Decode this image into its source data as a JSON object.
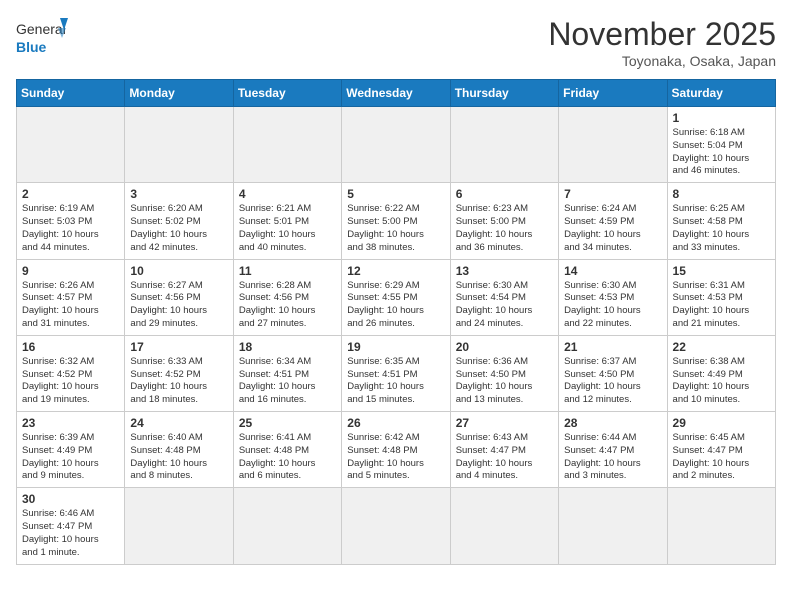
{
  "logo": {
    "text_general": "General",
    "text_blue": "Blue"
  },
  "title": "November 2025",
  "subtitle": "Toyonaka, Osaka, Japan",
  "weekdays": [
    "Sunday",
    "Monday",
    "Tuesday",
    "Wednesday",
    "Thursday",
    "Friday",
    "Saturday"
  ],
  "weeks": [
    [
      {
        "day": "",
        "info": "",
        "empty": true
      },
      {
        "day": "",
        "info": "",
        "empty": true
      },
      {
        "day": "",
        "info": "",
        "empty": true
      },
      {
        "day": "",
        "info": "",
        "empty": true
      },
      {
        "day": "",
        "info": "",
        "empty": true
      },
      {
        "day": "",
        "info": "",
        "empty": true
      },
      {
        "day": "1",
        "info": "Sunrise: 6:18 AM\nSunset: 5:04 PM\nDaylight: 10 hours\nand 46 minutes."
      }
    ],
    [
      {
        "day": "2",
        "info": "Sunrise: 6:19 AM\nSunset: 5:03 PM\nDaylight: 10 hours\nand 44 minutes."
      },
      {
        "day": "3",
        "info": "Sunrise: 6:20 AM\nSunset: 5:02 PM\nDaylight: 10 hours\nand 42 minutes."
      },
      {
        "day": "4",
        "info": "Sunrise: 6:21 AM\nSunset: 5:01 PM\nDaylight: 10 hours\nand 40 minutes."
      },
      {
        "day": "5",
        "info": "Sunrise: 6:22 AM\nSunset: 5:00 PM\nDaylight: 10 hours\nand 38 minutes."
      },
      {
        "day": "6",
        "info": "Sunrise: 6:23 AM\nSunset: 5:00 PM\nDaylight: 10 hours\nand 36 minutes."
      },
      {
        "day": "7",
        "info": "Sunrise: 6:24 AM\nSunset: 4:59 PM\nDaylight: 10 hours\nand 34 minutes."
      },
      {
        "day": "8",
        "info": "Sunrise: 6:25 AM\nSunset: 4:58 PM\nDaylight: 10 hours\nand 33 minutes."
      }
    ],
    [
      {
        "day": "9",
        "info": "Sunrise: 6:26 AM\nSunset: 4:57 PM\nDaylight: 10 hours\nand 31 minutes."
      },
      {
        "day": "10",
        "info": "Sunrise: 6:27 AM\nSunset: 4:56 PM\nDaylight: 10 hours\nand 29 minutes."
      },
      {
        "day": "11",
        "info": "Sunrise: 6:28 AM\nSunset: 4:56 PM\nDaylight: 10 hours\nand 27 minutes."
      },
      {
        "day": "12",
        "info": "Sunrise: 6:29 AM\nSunset: 4:55 PM\nDaylight: 10 hours\nand 26 minutes."
      },
      {
        "day": "13",
        "info": "Sunrise: 6:30 AM\nSunset: 4:54 PM\nDaylight: 10 hours\nand 24 minutes."
      },
      {
        "day": "14",
        "info": "Sunrise: 6:30 AM\nSunset: 4:53 PM\nDaylight: 10 hours\nand 22 minutes."
      },
      {
        "day": "15",
        "info": "Sunrise: 6:31 AM\nSunset: 4:53 PM\nDaylight: 10 hours\nand 21 minutes."
      }
    ],
    [
      {
        "day": "16",
        "info": "Sunrise: 6:32 AM\nSunset: 4:52 PM\nDaylight: 10 hours\nand 19 minutes."
      },
      {
        "day": "17",
        "info": "Sunrise: 6:33 AM\nSunset: 4:52 PM\nDaylight: 10 hours\nand 18 minutes."
      },
      {
        "day": "18",
        "info": "Sunrise: 6:34 AM\nSunset: 4:51 PM\nDaylight: 10 hours\nand 16 minutes."
      },
      {
        "day": "19",
        "info": "Sunrise: 6:35 AM\nSunset: 4:51 PM\nDaylight: 10 hours\nand 15 minutes."
      },
      {
        "day": "20",
        "info": "Sunrise: 6:36 AM\nSunset: 4:50 PM\nDaylight: 10 hours\nand 13 minutes."
      },
      {
        "day": "21",
        "info": "Sunrise: 6:37 AM\nSunset: 4:50 PM\nDaylight: 10 hours\nand 12 minutes."
      },
      {
        "day": "22",
        "info": "Sunrise: 6:38 AM\nSunset: 4:49 PM\nDaylight: 10 hours\nand 10 minutes."
      }
    ],
    [
      {
        "day": "23",
        "info": "Sunrise: 6:39 AM\nSunset: 4:49 PM\nDaylight: 10 hours\nand 9 minutes."
      },
      {
        "day": "24",
        "info": "Sunrise: 6:40 AM\nSunset: 4:48 PM\nDaylight: 10 hours\nand 8 minutes."
      },
      {
        "day": "25",
        "info": "Sunrise: 6:41 AM\nSunset: 4:48 PM\nDaylight: 10 hours\nand 6 minutes."
      },
      {
        "day": "26",
        "info": "Sunrise: 6:42 AM\nSunset: 4:48 PM\nDaylight: 10 hours\nand 5 minutes."
      },
      {
        "day": "27",
        "info": "Sunrise: 6:43 AM\nSunset: 4:47 PM\nDaylight: 10 hours\nand 4 minutes."
      },
      {
        "day": "28",
        "info": "Sunrise: 6:44 AM\nSunset: 4:47 PM\nDaylight: 10 hours\nand 3 minutes."
      },
      {
        "day": "29",
        "info": "Sunrise: 6:45 AM\nSunset: 4:47 PM\nDaylight: 10 hours\nand 2 minutes."
      }
    ],
    [
      {
        "day": "30",
        "info": "Sunrise: 6:46 AM\nSunset: 4:47 PM\nDaylight: 10 hours\nand 1 minute."
      },
      {
        "day": "",
        "info": "",
        "empty": true
      },
      {
        "day": "",
        "info": "",
        "empty": true
      },
      {
        "day": "",
        "info": "",
        "empty": true
      },
      {
        "day": "",
        "info": "",
        "empty": true
      },
      {
        "day": "",
        "info": "",
        "empty": true
      },
      {
        "day": "",
        "info": "",
        "empty": true
      }
    ]
  ]
}
